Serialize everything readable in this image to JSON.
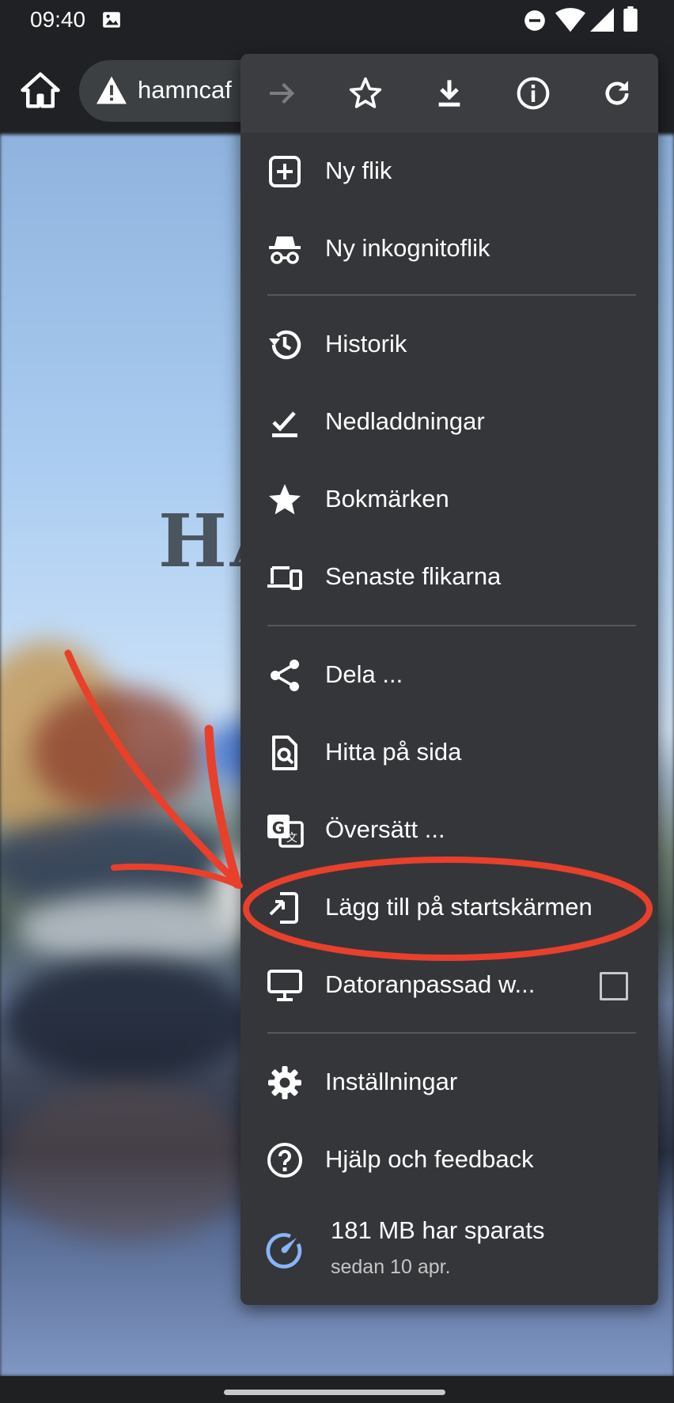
{
  "status_bar": {
    "time": "09:40",
    "icons": [
      "image-icon",
      "dnd-icon",
      "wifi-icon",
      "signal-icon",
      "battery-icon"
    ]
  },
  "toolbar": {
    "url": "hamncaf",
    "icons": [
      "home-icon",
      "warning-icon"
    ]
  },
  "page": {
    "logo_text": "HA"
  },
  "menu": {
    "toolbar_icons": [
      "forward-icon",
      "star-outline-icon",
      "download-icon",
      "info-icon",
      "refresh-icon"
    ],
    "items": [
      {
        "label": "Ny flik",
        "icon": "new-tab-icon"
      },
      {
        "label": "Ny inkognitoflik",
        "icon": "incognito-icon"
      },
      {
        "label": "Historik",
        "icon": "history-icon"
      },
      {
        "label": "Nedladdningar",
        "icon": "downloads-icon"
      },
      {
        "label": "Bokmärken",
        "icon": "star-icon"
      },
      {
        "label": "Senaste flikarna",
        "icon": "devices-icon"
      },
      {
        "label": "Dela ...",
        "icon": "share-icon"
      },
      {
        "label": "Hitta på sida",
        "icon": "find-in-page-icon"
      },
      {
        "label": "Översätt ...",
        "icon": "translate-icon"
      },
      {
        "label": "Lägg till på startskärmen",
        "icon": "add-to-home-icon"
      },
      {
        "label": "Datoranpassad w...",
        "icon": "desktop-icon",
        "checked": false
      },
      {
        "label": "Inställningar",
        "icon": "settings-icon"
      },
      {
        "label": "Hjälp och feedback",
        "icon": "help-icon"
      }
    ],
    "data_saver": {
      "label": "181 MB har sparats",
      "sublabel": "sedan 10 apr.",
      "icon": "speedometer-icon"
    }
  },
  "colors": {
    "menu_bg": "#35363a",
    "text": "#ffffff",
    "annotation_red": "#e8402b",
    "data_saver_blue": "#8ab4f8"
  }
}
